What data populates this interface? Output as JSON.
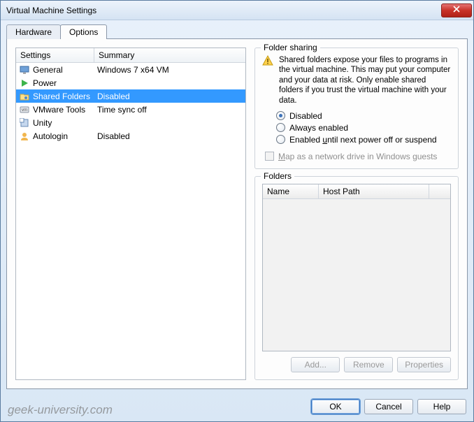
{
  "window": {
    "title": "Virtual Machine Settings"
  },
  "tabs": {
    "hardware": "Hardware",
    "options": "Options"
  },
  "settings_list": {
    "header_settings": "Settings",
    "header_summary": "Summary",
    "items": [
      {
        "label": "General",
        "summary": "Windows 7 x64 VM",
        "icon": "monitor-icon"
      },
      {
        "label": "Power",
        "summary": "",
        "icon": "play-icon"
      },
      {
        "label": "Shared Folders",
        "summary": "Disabled",
        "icon": "folder-share-icon",
        "selected": true
      },
      {
        "label": "VMware Tools",
        "summary": "Time sync off",
        "icon": "vm-icon"
      },
      {
        "label": "Unity",
        "summary": "",
        "icon": "unity-icon"
      },
      {
        "label": "Autologin",
        "summary": "Disabled",
        "icon": "user-icon"
      }
    ]
  },
  "folder_sharing": {
    "group_title": "Folder sharing",
    "warning_text": "Shared folders expose your files to programs in the virtual machine. This may put your computer and your data at risk. Only enable shared folders if you trust the virtual machine with your data.",
    "radios": {
      "disabled": "Disabled",
      "always": "Always enabled",
      "until_off_prefix": "Enabled ",
      "until_off_hotkey": "u",
      "until_off_suffix": "ntil next power off or suspend"
    },
    "map_drive_prefix": "",
    "map_drive_hotkey": "M",
    "map_drive_suffix": "ap as a network drive in Windows guests"
  },
  "folders": {
    "group_title": "Folders",
    "header_name": "Name",
    "header_path": "Host Path",
    "buttons": {
      "add": "Add...",
      "remove": "Remove",
      "properties": "Properties"
    }
  },
  "bottom": {
    "ok": "OK",
    "cancel": "Cancel",
    "help": "Help"
  },
  "watermark": "geek-university.com"
}
